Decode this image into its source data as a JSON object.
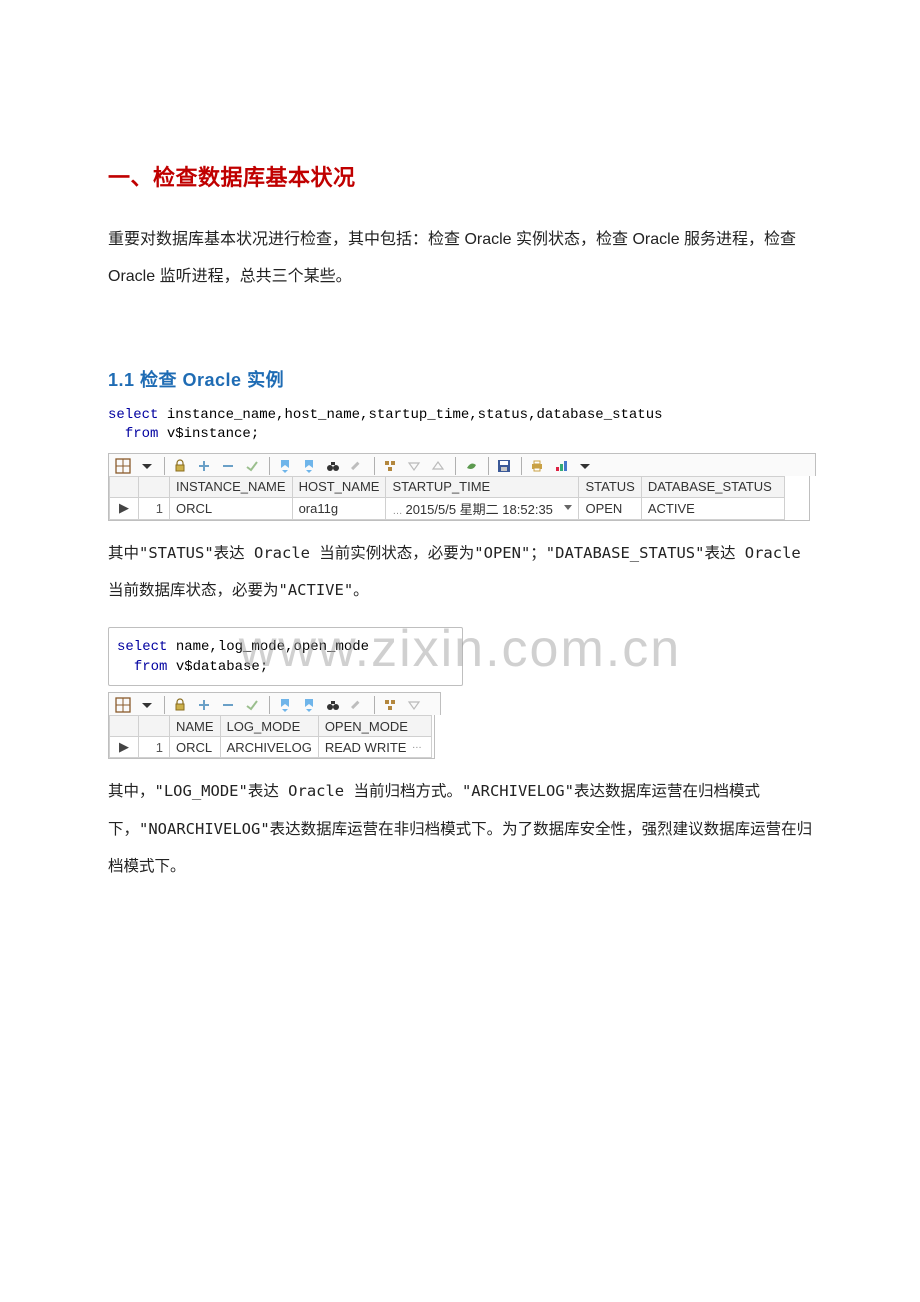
{
  "watermark": "www.zixin.com.cn",
  "heading1": "一、检查数据库基本状况",
  "intro": "重要对数据库基本状况进行检查，其中包括：检查 Oracle 实例状态，检查 Oracle 服务进程，检查 Oracle 监听进程，总共三个某些。",
  "heading2": "1.1 检查 Oracle 实例",
  "sql1": {
    "kw_select": "select",
    "cols": " instance_name,host_name,startup_time,status,database_status",
    "kw_from": "from",
    "tbl": " v$instance;"
  },
  "grid1": {
    "headers": [
      "",
      "",
      "INSTANCE_NAME",
      "HOST_NAME",
      "STARTUP_TIME",
      "STATUS",
      "DATABASE_STATUS"
    ],
    "row": {
      "marker": "▶",
      "num": "1",
      "instance_name": "ORCL",
      "host_name": "ora11g",
      "startup_ellipsis": "…",
      "startup_time": "2015/5/5 星期二 18:52:35",
      "status": "OPEN",
      "database_status": "ACTIVE"
    }
  },
  "para1": "其中\"STATUS\"表达 Oracle 当前实例状态，必要为\"OPEN\"；\"DATABASE_STATUS\"表达 Oracle 当前数据库状态，必要为\"ACTIVE\"。",
  "sql2": {
    "kw_select": "select",
    "cols": " name,log_mode,open_mode",
    "kw_from": "from",
    "tbl": " v$database;"
  },
  "grid2": {
    "headers": [
      "",
      "",
      "NAME",
      "LOG_MODE",
      "OPEN_MODE"
    ],
    "row": {
      "marker": "▶",
      "num": "1",
      "name": "ORCL",
      "log_mode": "ARCHIVELOG",
      "open_mode": "READ WRITE",
      "open_mode_ellipsis": "…"
    }
  },
  "para2": "其中，\"LOG_MODE\"表达 Oracle 当前归档方式。\"ARCHIVELOG\"表达数据库运营在归档模式下，\"NOARCHIVELOG\"表达数据库运营在非归档模式下。为了数据库安全性，强烈建议数据库运营在归档模式下。"
}
